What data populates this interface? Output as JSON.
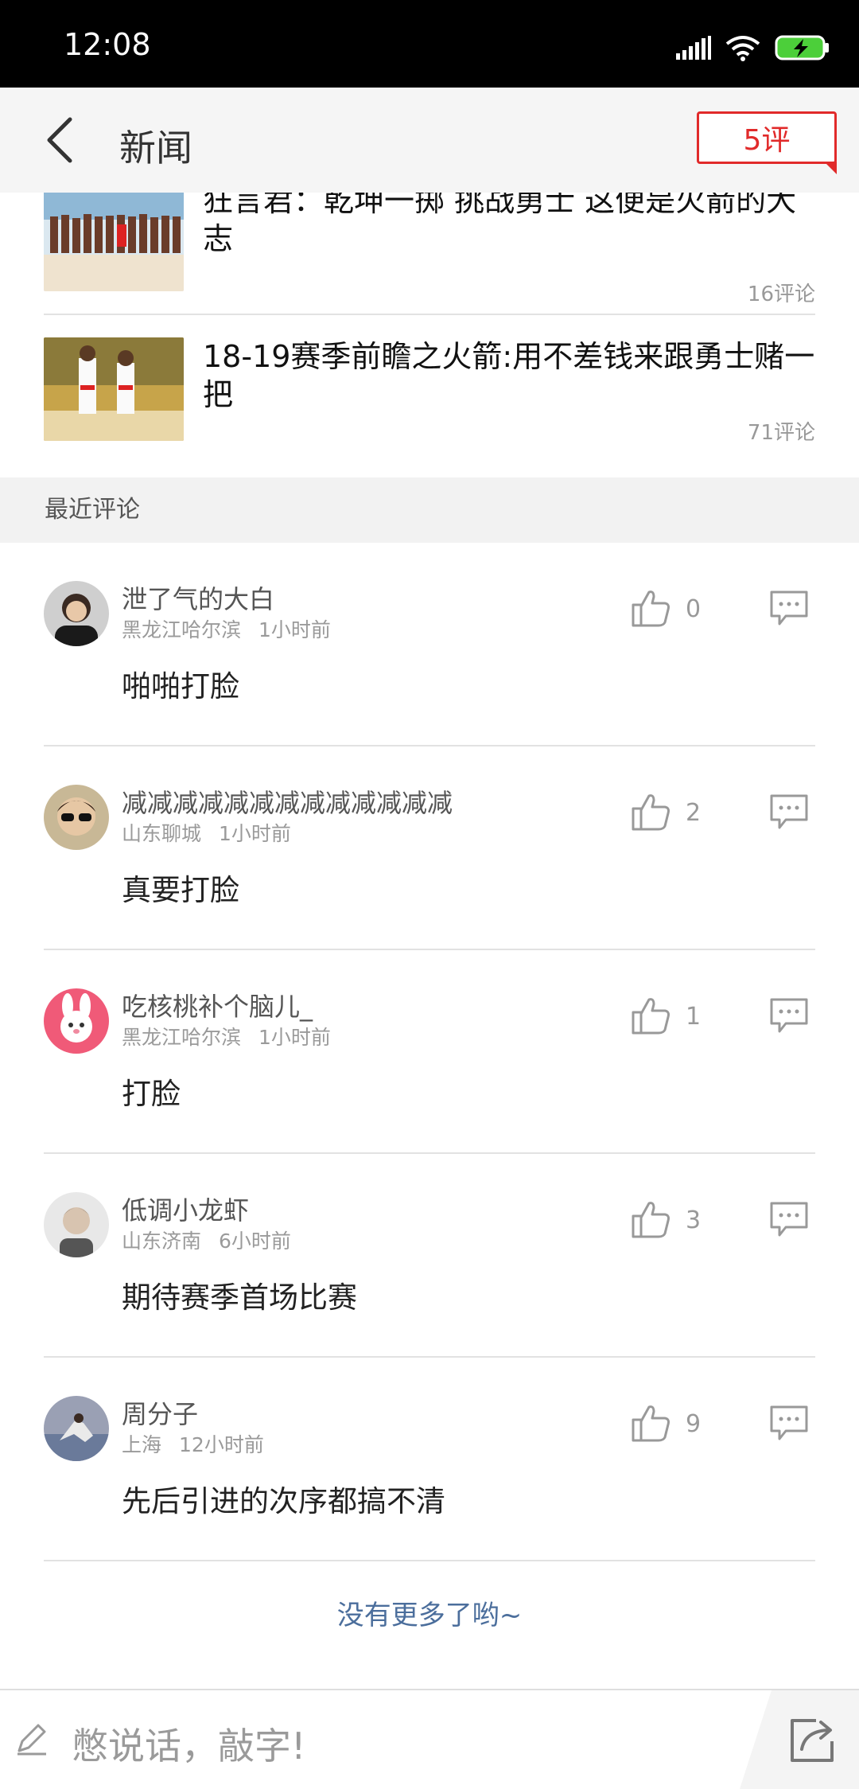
{
  "status_bar": {
    "time": "12:08"
  },
  "nav": {
    "title": "新闻",
    "comment_count": "5评"
  },
  "articles": [
    {
      "title": "狂言君：乾坤一掷 挑战勇士 这便是火箭的大志",
      "comments": "16评论"
    },
    {
      "title": "18-19赛季前瞻之火箭:用不差钱来跟勇士赌一把",
      "comments": "71评论"
    }
  ],
  "section": {
    "title": "最近评论"
  },
  "comments": [
    {
      "name": "泄了气的大白",
      "location": "黑龙江哈尔滨",
      "time": "1小时前",
      "text": "啪啪打脸",
      "likes": "0"
    },
    {
      "name": "减减减减减减减减减减减减减",
      "location": "山东聊城",
      "time": "1小时前",
      "text": "真要打脸",
      "likes": "2"
    },
    {
      "name": "吃核桃补个脑儿_",
      "location": "黑龙江哈尔滨",
      "time": "1小时前",
      "text": "打脸",
      "likes": "1"
    },
    {
      "name": "低调小龙虾",
      "location": "山东济南",
      "time": "6小时前",
      "text": "期待赛季首场比赛",
      "likes": "3"
    },
    {
      "name": "周分子",
      "location": "上海",
      "time": "12小时前",
      "text": "先后引进的次序都搞不清",
      "likes": "9"
    }
  ],
  "footer": {
    "no_more": "没有更多了哟~"
  },
  "bottom_bar": {
    "input_placeholder": "憋说话，敲字!"
  },
  "colors": {
    "accent": "#e12a2a",
    "link": "#4b6e9c"
  }
}
